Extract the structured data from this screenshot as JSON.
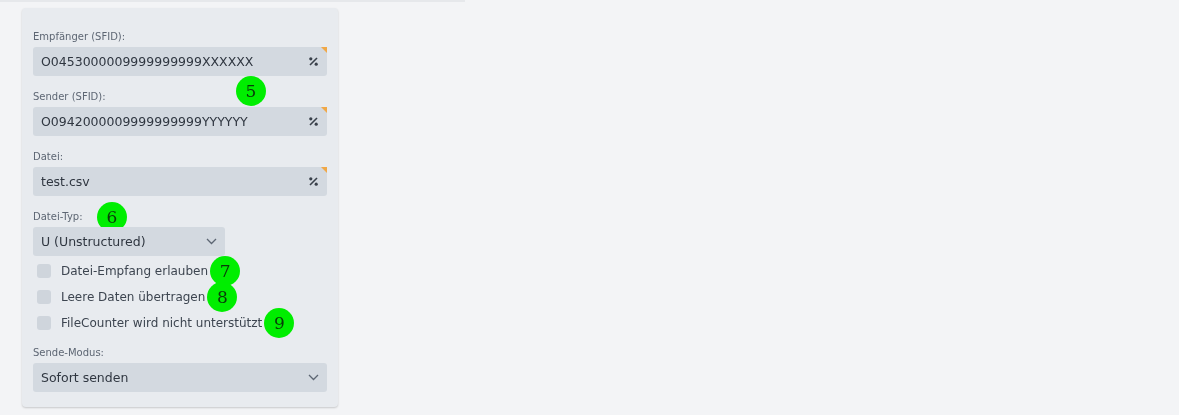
{
  "fields": [
    {
      "label": "Empfänger (SFID):",
      "value": "O0453000009999999999XXXXXX",
      "marker": "5"
    },
    {
      "label": "Sender (SFID):",
      "value": "O0942000009999999999YYYYYY"
    },
    {
      "label": "Datei:",
      "value": "test.csv"
    }
  ],
  "file_type": {
    "label": "Datei-Typ:",
    "value": "U (Unstructured)",
    "marker": "6"
  },
  "checkboxes": [
    {
      "label": "Datei-Empfang erlauben",
      "checked": false,
      "marker": "7"
    },
    {
      "label": "Leere Daten übertragen",
      "checked": false,
      "marker": "8"
    },
    {
      "label": "FileCounter wird nicht unterstützt",
      "checked": false,
      "marker": "9"
    }
  ],
  "send_mode": {
    "label": "Sende-Modus:",
    "value": "Sofort senden"
  }
}
